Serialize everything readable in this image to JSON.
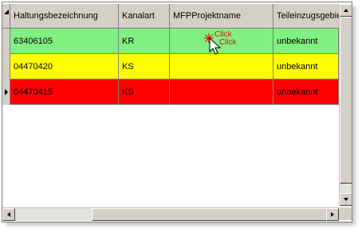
{
  "grid": {
    "columns": [
      "Haltungsbezeichnung",
      "Kanalart",
      "MFPProjektname",
      "Teileinzugsgebiet"
    ],
    "rows": [
      {
        "id": "63406105",
        "kanalart": "KR",
        "projekt": "",
        "teil": "unbekannt",
        "color": "#80f080"
      },
      {
        "id": "04470420",
        "kanalart": "KS",
        "projekt": "",
        "teil": "unbekannt",
        "color": "#ffff00"
      },
      {
        "id": "04470415",
        "kanalart": "KS",
        "projekt": "",
        "teil": "unbekannt",
        "color": "#ff0000"
      }
    ]
  },
  "overlay": {
    "click1": "Click",
    "click2": "Click"
  },
  "icons": {
    "sort": "sort-triangle-icon",
    "row_pointer": "row-pointer-icon",
    "cursor": "mouse-cursor-icon",
    "scroll_up": "arrow-up-icon",
    "scroll_down": "arrow-down-icon",
    "scroll_left": "arrow-left-icon",
    "scroll_right": "arrow-right-icon"
  }
}
